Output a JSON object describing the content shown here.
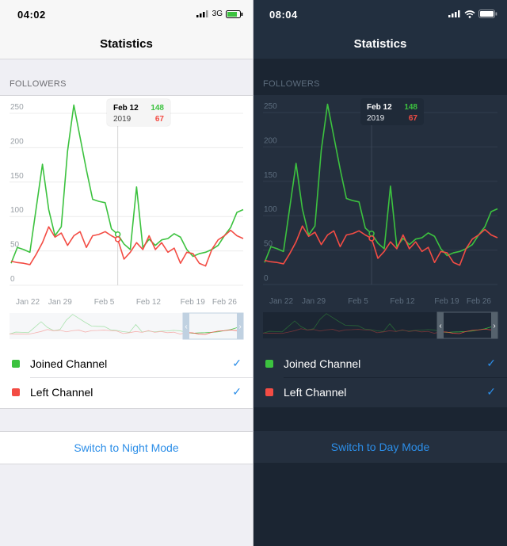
{
  "colors": {
    "joined": "#3cc23f",
    "left": "#f34c44",
    "accent": "#2c8ee8"
  },
  "light": {
    "status_time": "04:02",
    "network": "3G",
    "title": "Statistics",
    "section": "FOLLOWERS",
    "tooltip": {
      "date": "Feb 12",
      "year": "2019",
      "joined": "148",
      "left": "67"
    },
    "legend": [
      {
        "label": "Joined Channel",
        "icon": "check-icon"
      },
      {
        "label": "Left Channel",
        "icon": "check-icon"
      }
    ],
    "switch_label": "Switch to Night Mode"
  },
  "dark": {
    "status_time": "08:04",
    "title": "Statistics",
    "section": "FOLLOWERS",
    "tooltip": {
      "date": "Feb 12",
      "year": "2019",
      "joined": "148",
      "left": "67"
    },
    "legend": [
      {
        "label": "Joined Channel",
        "icon": "check-icon"
      },
      {
        "label": "Left Channel",
        "icon": "check-icon"
      }
    ],
    "switch_label": "Switch to Day Mode"
  },
  "chart_data": {
    "type": "line",
    "y_ticks": [
      "250",
      "200",
      "150",
      "100",
      "50",
      "0"
    ],
    "ylim": [
      0,
      250
    ],
    "x_ticks": [
      "Jan 22",
      "Jan 29",
      "Feb 5",
      "Feb 12",
      "Feb 19",
      "Feb 26"
    ],
    "x": [
      0,
      1,
      2,
      3,
      4,
      5,
      6,
      7,
      8,
      9,
      10,
      11,
      12,
      13,
      14,
      15,
      16,
      17,
      18,
      19,
      20,
      21,
      22,
      23,
      24,
      25,
      26,
      27,
      28,
      29,
      30,
      31,
      32,
      33,
      34,
      35,
      36,
      37
    ],
    "series": [
      {
        "name": "Joined Channel",
        "values": [
          32,
          55,
          52,
          48,
          112,
          176,
          110,
          72,
          85,
          195,
          262,
          215,
          168,
          125,
          122,
          120,
          82,
          74,
          60,
          52,
          143,
          55,
          67,
          58,
          66,
          68,
          75,
          70,
          52,
          42,
          46,
          48,
          52,
          58,
          72,
          84,
          106,
          110
        ]
      },
      {
        "name": "Left Channel",
        "values": [
          35,
          33,
          32,
          30,
          45,
          62,
          85,
          70,
          76,
          58,
          72,
          78,
          55,
          72,
          74,
          78,
          72,
          67,
          38,
          48,
          62,
          52,
          72,
          52,
          62,
          48,
          54,
          32,
          48,
          46,
          32,
          28,
          52,
          66,
          72,
          80,
          72,
          68
        ]
      }
    ],
    "tooltip_index": 17
  }
}
